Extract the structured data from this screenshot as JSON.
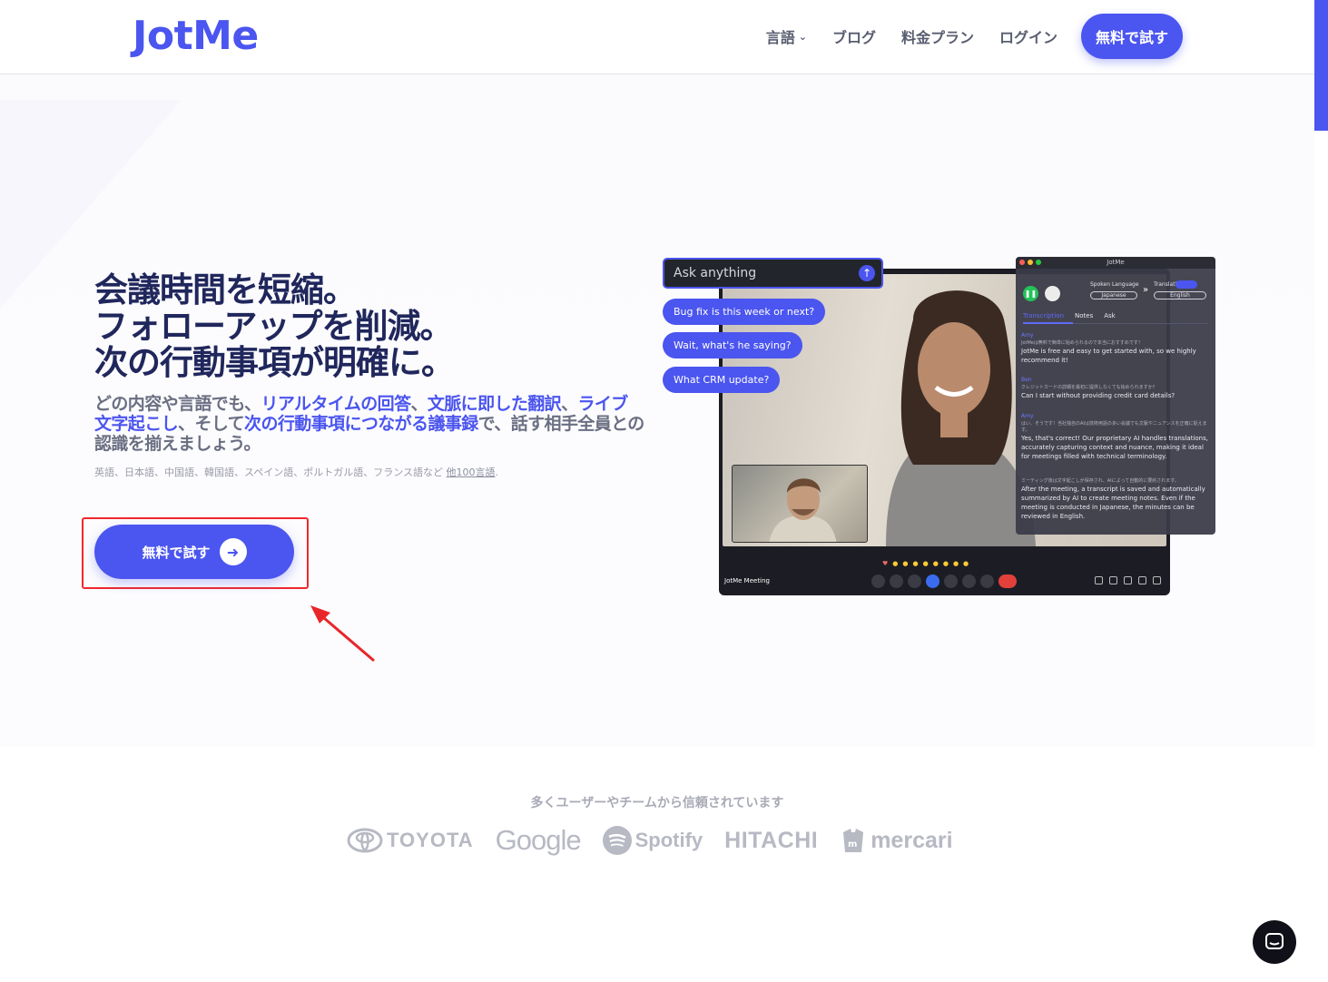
{
  "header": {
    "logo": "JotMe",
    "nav": [
      {
        "label": "言語",
        "has_dropdown": true
      },
      {
        "label": "ブログ"
      },
      {
        "label": "料金プラン"
      },
      {
        "label": "ログイン"
      }
    ],
    "cta": "無料で試す"
  },
  "hero": {
    "title_lines": [
      "会議時間を短縮。",
      "フォローアップを削減。",
      "次の行動事項が明確に。"
    ],
    "subtitle": {
      "p1": "どの内容や言語でも、",
      "h1": "リアルタイムの回答",
      "p2": "、",
      "h2": "文脈に即した翻訳",
      "p3": "、",
      "h3": "ライブ文字起こし",
      "p4": "、そして",
      "h4": "次の行動事項につながる議事録",
      "p5": "で、話す相手全員との認識を揃えましょう。"
    },
    "languages_text": "英語、日本語、中国語、韓国語、スペイン語、ポルトガル語、フランス語など ",
    "languages_link": "他100言語",
    "languages_end": ".",
    "cta": "無料で試す"
  },
  "demo": {
    "ask_placeholder": "Ask anything",
    "chips": [
      "Bug fix is this week or next?",
      "Wait, what's he saying?",
      "What CRM update?"
    ],
    "meeting_label": "JotMe Meeting",
    "panel": {
      "title": "JotMe",
      "spoken_language_label": "Spoken Language",
      "spoken_language_value": "Japanese",
      "translation_label": "Translation",
      "translation_value": "English",
      "tabs": [
        "Transcription",
        "Notes",
        "Ask"
      ],
      "entries": [
        {
          "speaker": "Amy",
          "jp": "JotMeは無料で簡単に始められるので本当におすすめです！",
          "en": "JotMe is free and easy to get started with, so we highly recommend it!"
        },
        {
          "speaker": "Ben",
          "jp": "クレジットカードの詳細を最初に提供しなくても始められますか？",
          "en": "Can I start without providing credit card details?"
        },
        {
          "speaker": "Amy",
          "jp": "はい、そうです！当社独自のAIは技術用語の多い会議でも文脈やニュアンスを正確に捉えます。",
          "en": "Yes, that's correct! Our proprietary AI handles translations, accurately capturing context and nuance, making it ideal for meetings filled with technical terminology."
        },
        {
          "speaker": "",
          "jp": "ミーティング後は文字起こしが保存され、AIによって自動的に要約されます。",
          "en": "After the meeting, a transcript is saved and automatically summarized by AI to create meeting notes. Even if the meeting is conducted in Japanese, the minutes can be reviewed in English."
        }
      ]
    }
  },
  "trust": {
    "heading": "多くユーザーやチームから信頼されています",
    "logos": [
      "TOYOTA",
      "Google",
      "Spotify",
      "HITACHI",
      "mercari"
    ]
  },
  "colors": {
    "brand": "#4b55ef",
    "heading": "#20275c",
    "annotation": "#f0282c"
  },
  "icons": [
    "chevron-down-icon",
    "arrow-right-icon",
    "send-icon",
    "chat-launcher-icon"
  ]
}
